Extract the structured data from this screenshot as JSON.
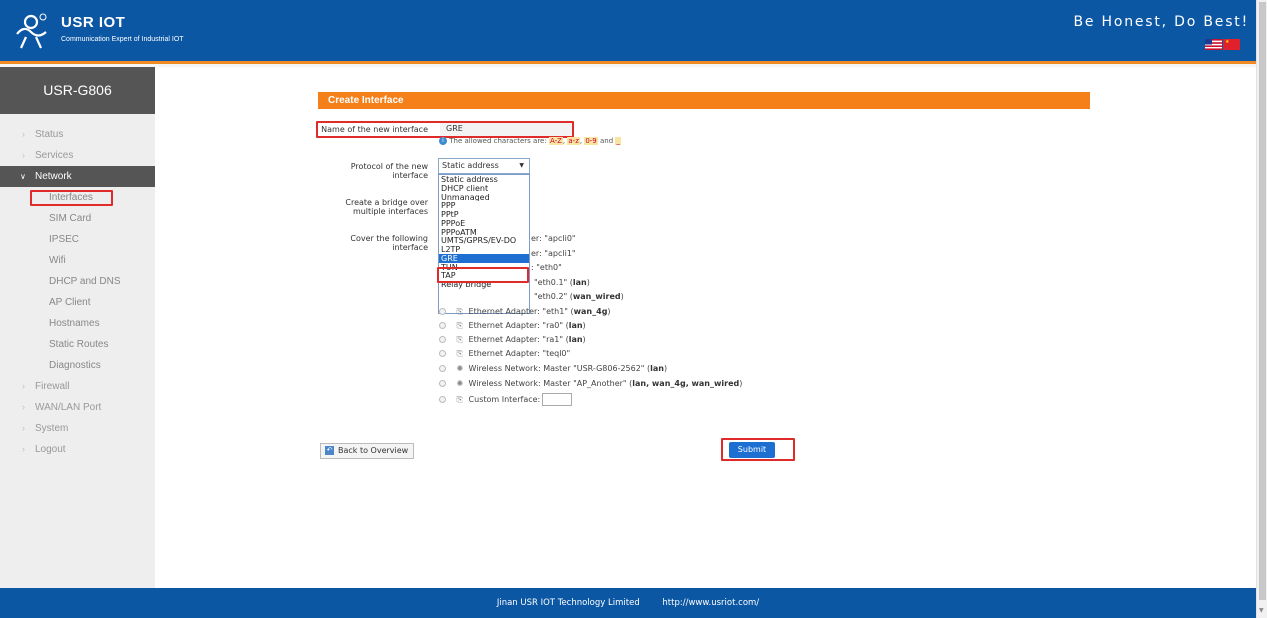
{
  "header": {
    "brand_name": "USR IOT",
    "brand_tagline": "Communication Expert of Industrial IOT",
    "slogan": "Be Honest, Do Best!",
    "colors": {
      "header_bg": "#0b57a4",
      "accent": "#f08a24"
    }
  },
  "sidebar": {
    "device_title": "USR-G806",
    "items": [
      {
        "label": "Status"
      },
      {
        "label": "Services"
      },
      {
        "label": "Network"
      },
      {
        "label": "Interfaces"
      },
      {
        "label": "SIM Card"
      },
      {
        "label": "IPSEC"
      },
      {
        "label": "Wifi"
      },
      {
        "label": "DHCP and DNS"
      },
      {
        "label": "AP Client"
      },
      {
        "label": "Hostnames"
      },
      {
        "label": "Static Routes"
      },
      {
        "label": "Diagnostics"
      },
      {
        "label": "Firewall"
      },
      {
        "label": "WAN/LAN Port"
      },
      {
        "label": "System"
      },
      {
        "label": "Logout"
      }
    ]
  },
  "form": {
    "title": "Create Interface",
    "name_label": "Name of the new interface",
    "name_value": "GRE",
    "hint_prefix": "The allowed characters are:",
    "hint_tok1": "A-Z",
    "hint_tok2": "a-z",
    "hint_tok3": "0-9",
    "hint_and": "and",
    "hint_tok4": "_",
    "protocol_label_1": "Protocol of the new",
    "protocol_label_2": "interface",
    "protocol_selected": "Static address",
    "protocol_options": [
      "Static address",
      "DHCP client",
      "Unmanaged",
      "PPP",
      "PPtP",
      "PPPoE",
      "PPPoATM",
      "UMTS/GPRS/EV-DO",
      "L2TP",
      "GRE",
      "TUN",
      "TAP",
      "Relay bridge"
    ],
    "bridge_label_1": "Create a bridge over",
    "bridge_label_2": "multiple interfaces",
    "cover_label_1": "Cover the following",
    "cover_label_2": "interface",
    "partial_rows": {
      "apcli0": "er: \"apcli0\"",
      "apcli1": "er: \"apcli1\"",
      "eth0": ": \"eth0\"",
      "eth01_text": "\"eth0.1\" (",
      "eth01_zone": "lan",
      "eth02_text": "\"eth0.2\" (",
      "eth02_zone": "wan_wired"
    },
    "eth1_row_prefix": "Ethernet Adapter: \"eth1\" (",
    "eth1_zone": "wan_4g",
    "rows": [
      {
        "text": "Ethernet Adapter: \"ra0\" (",
        "zone": "lan"
      },
      {
        "text": "Ethernet Adapter: \"ra1\" (",
        "zone": "lan"
      },
      {
        "text": "Ethernet Adapter: \"teql0\""
      },
      {
        "text": "Wireless Network: Master \"USR-G806-2562\" (",
        "zone": "lan"
      },
      {
        "text": "Wireless Network: Master \"AP_Another\" (",
        "zone": "lan, wan_4g, wan_wired"
      },
      {
        "text": "Custom Interface:"
      }
    ],
    "back_label": "Back to Overview",
    "submit_label": "Submit"
  },
  "footer": {
    "company": "Jinan USR IOT Technology Limited",
    "url": "http://www.usriot.com/"
  }
}
